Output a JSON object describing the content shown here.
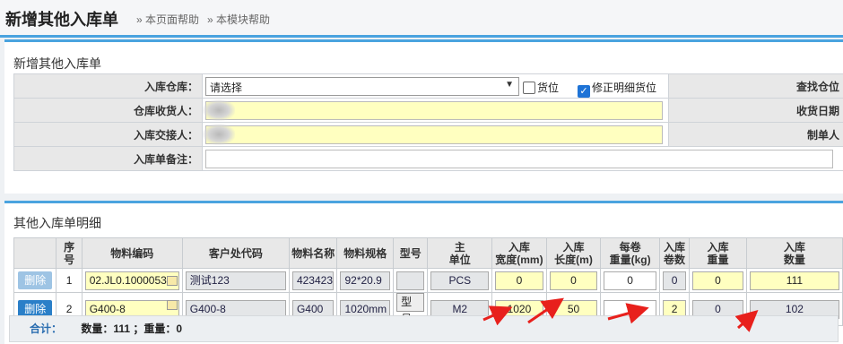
{
  "page": {
    "title": "新增其他入库单",
    "help_page": "» 本页面帮助",
    "help_module": "» 本模块帮助"
  },
  "form_panel": {
    "title": "新增其他入库单",
    "warehouse_label": "入库仓库：",
    "warehouse_value": "请选择",
    "location_checkbox_label": "货位",
    "location_checked": false,
    "fix_detail_checkbox_label": "修正明细货位",
    "fix_detail_checked": true,
    "find_location_label": "查找仓位",
    "receiver_label": "仓库收货人：",
    "receive_date_label": "收货日期",
    "handover_label": "入库交接人：",
    "creator_label": "制单人",
    "remark_label": "入库单备注："
  },
  "detail_panel": {
    "title": "其他入库单明细",
    "columns": [
      "",
      "序号",
      "物料编码",
      "客户处代码",
      "物料名称",
      "物料规格",
      "型号",
      "主\n单位",
      "入库\n宽度(mm)",
      "入库\n长度(m)",
      "每卷\n重量(kg)",
      "入库\n卷数",
      "入库\n重量",
      "入库\n数量"
    ],
    "rows": [
      {
        "action": "删除",
        "action_enabled": false,
        "seq": "1",
        "material_code": "02.JL0.1000053",
        "customer_code": "测试123",
        "material_name": "423423",
        "spec": "92*20.9",
        "model": "",
        "unit": "PCS",
        "width": "0",
        "length": "0",
        "roll_weight": "0",
        "rolls": "0",
        "weight": "0",
        "quantity": "111"
      },
      {
        "action": "删除",
        "action_enabled": true,
        "seq": "2",
        "material_code": "G400-8",
        "customer_code": "G400-8",
        "material_name": "G400",
        "spec": "1020mm",
        "model": "型号",
        "unit": "M2",
        "width": "1020",
        "length": "50",
        "roll_weight": "0",
        "rolls": "2",
        "weight": "0",
        "quantity": "102"
      }
    ],
    "footer": {
      "total_label": "合计：",
      "summary": "数量：111 ；重量：0"
    }
  },
  "colors": {
    "accent": "#4aa3df",
    "highlight_yellow": "#ffffc0",
    "arrow_red": "#e8201c",
    "button_blue": "#2a7fc8"
  }
}
